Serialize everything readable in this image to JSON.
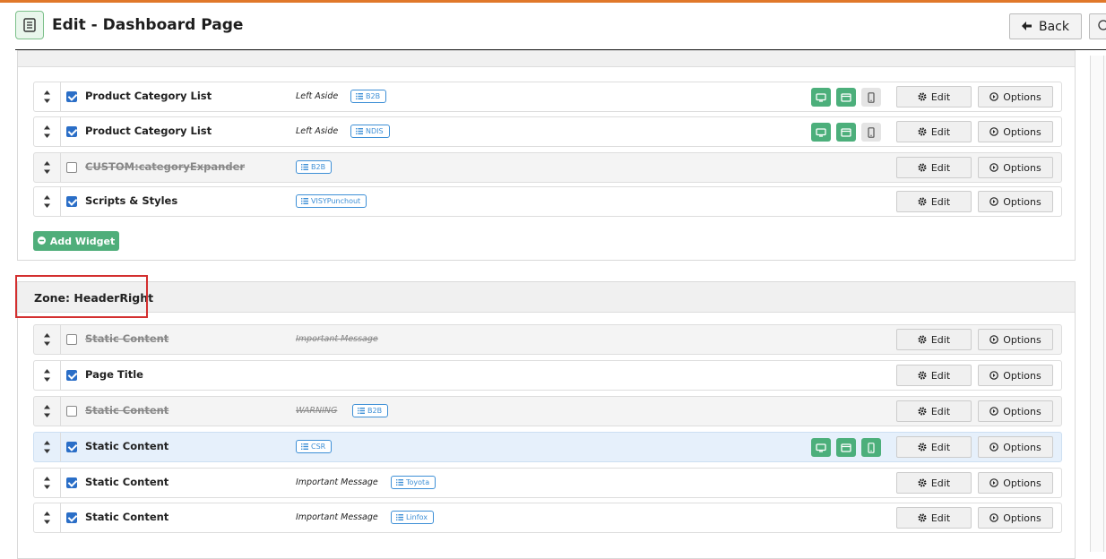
{
  "header": {
    "title": "Edit - Dashboard Page",
    "back_label": "Back",
    "page_icon": "document-icon",
    "back_icon": "arrow-left-icon"
  },
  "zone_previous": {
    "add_widget_label": "Add Widget",
    "rows": [
      {
        "name": "Product Category List",
        "enabled": true,
        "location": "Left Aside",
        "tag": "B2B",
        "devices": [
          true,
          true,
          false
        ]
      },
      {
        "name": "Product Category List",
        "enabled": true,
        "location": "Left Aside",
        "tag": "NDIS",
        "devices": [
          true,
          true,
          false
        ]
      },
      {
        "name": "CUSTOM:categoryExpander",
        "enabled": false,
        "location": "",
        "tag": "B2B",
        "devices": null
      },
      {
        "name": "Scripts & Styles",
        "enabled": true,
        "location": "",
        "tag": "VISYPunchout",
        "devices": null
      }
    ]
  },
  "zone_header_right": {
    "title": "Zone: HeaderRight",
    "rows": [
      {
        "name": "Static Content",
        "enabled": false,
        "location": "Important Message",
        "tag": "",
        "devices": null
      },
      {
        "name": "Page Title",
        "enabled": true,
        "location": "",
        "tag": "",
        "devices": null
      },
      {
        "name": "Static Content",
        "enabled": false,
        "location": "WARNING",
        "tag": "B2B",
        "devices": null
      },
      {
        "name": "Static Content",
        "enabled": true,
        "location": "",
        "tag": "CSR",
        "devices": [
          true,
          true,
          true
        ],
        "selected": true
      },
      {
        "name": "Static Content",
        "enabled": true,
        "location": "Important Message",
        "tag": "Toyota",
        "devices": null
      },
      {
        "name": "Static Content",
        "enabled": true,
        "location": "Important Message",
        "tag": "Linfox",
        "devices": null
      }
    ]
  },
  "buttons": {
    "edit_label": "Edit",
    "options_label": "Options"
  },
  "colors": {
    "accent_green": "#4caf7b",
    "tag_blue": "#3d8fd6",
    "highlight_red": "#d32f2f",
    "top_bar_orange": "#e0782a"
  }
}
